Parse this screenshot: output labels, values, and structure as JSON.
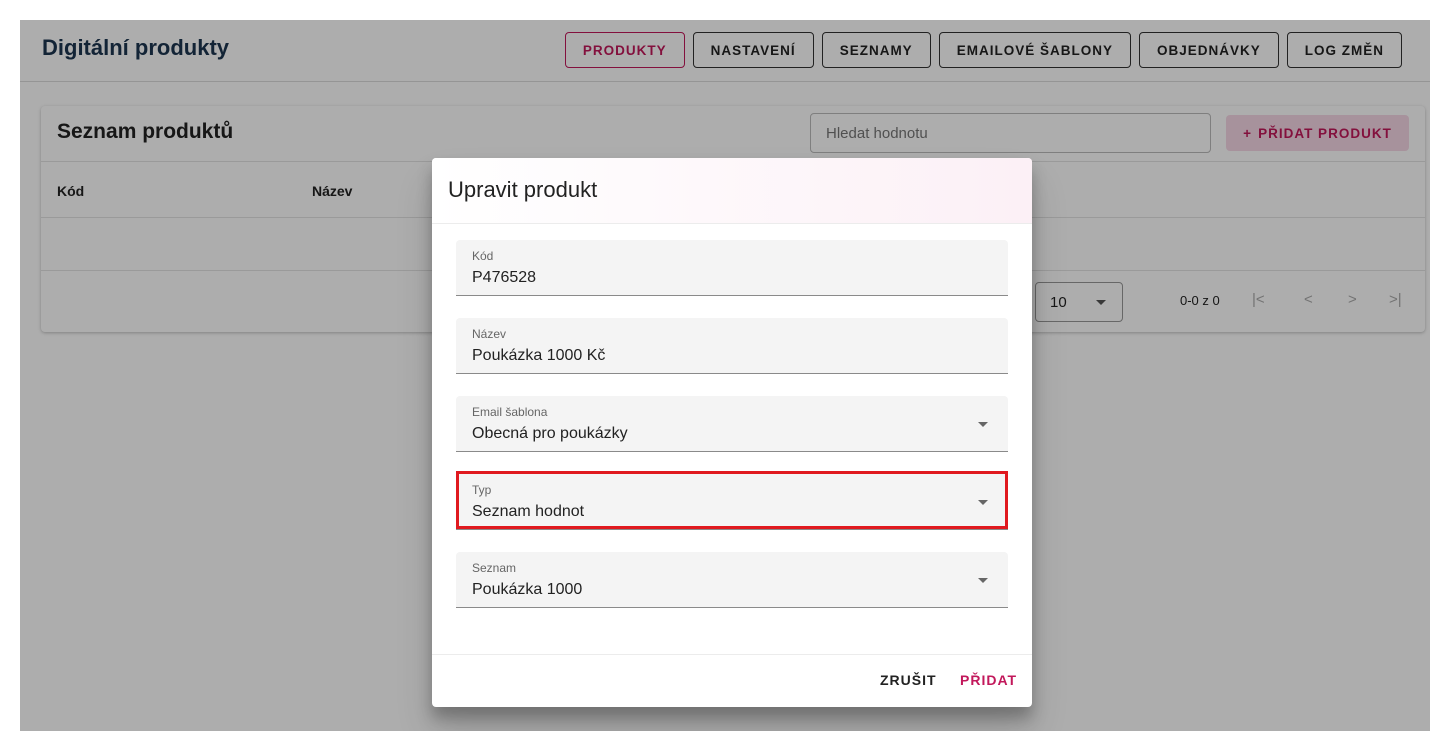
{
  "app": {
    "title": "Digitální produkty",
    "nav": [
      {
        "label": "PRODUKTY",
        "active": true
      },
      {
        "label": "NASTAVENÍ",
        "active": false
      },
      {
        "label": "SEZNAMY",
        "active": false
      },
      {
        "label": "EMAILOVÉ ŠABLONY",
        "active": false
      },
      {
        "label": "OBJEDNÁVKY",
        "active": false
      },
      {
        "label": "LOG ZMĚN",
        "active": false
      }
    ]
  },
  "list": {
    "title": "Seznam produktů",
    "search_placeholder": "Hledat hodnotu",
    "add_icon": "+",
    "add_label": "PŘIDAT PRODUKT",
    "columns": [
      "Kód",
      "Název"
    ],
    "rows_per_page": "10",
    "range": "0-0 z 0",
    "pager": {
      "first": "|<",
      "prev": "<",
      "next": ">",
      "last": ">|"
    }
  },
  "dialog": {
    "title": "Upravit produkt",
    "fields": [
      {
        "label": "Kód",
        "value": "P476528",
        "type": "text"
      },
      {
        "label": "Název",
        "value": "Poukázka 1000 Kč",
        "type": "text"
      },
      {
        "label": "Email šablona",
        "value": "Obecná pro poukázky",
        "type": "select"
      },
      {
        "label": "Typ",
        "value": "Seznam hodnot",
        "type": "select"
      },
      {
        "label": "Seznam",
        "value": "Poukázka 1000",
        "type": "select"
      }
    ],
    "cancel_label": "ZRUŠIT",
    "submit_label": "PŘIDAT"
  },
  "colors": {
    "accent": "#c2185b",
    "title": "#1d3550",
    "highlight": "#e0191f"
  },
  "icons": [
    "dropdown-caret-icon",
    "first-page-icon",
    "prev-page-icon",
    "next-page-icon",
    "last-page-icon",
    "plus-icon"
  ]
}
